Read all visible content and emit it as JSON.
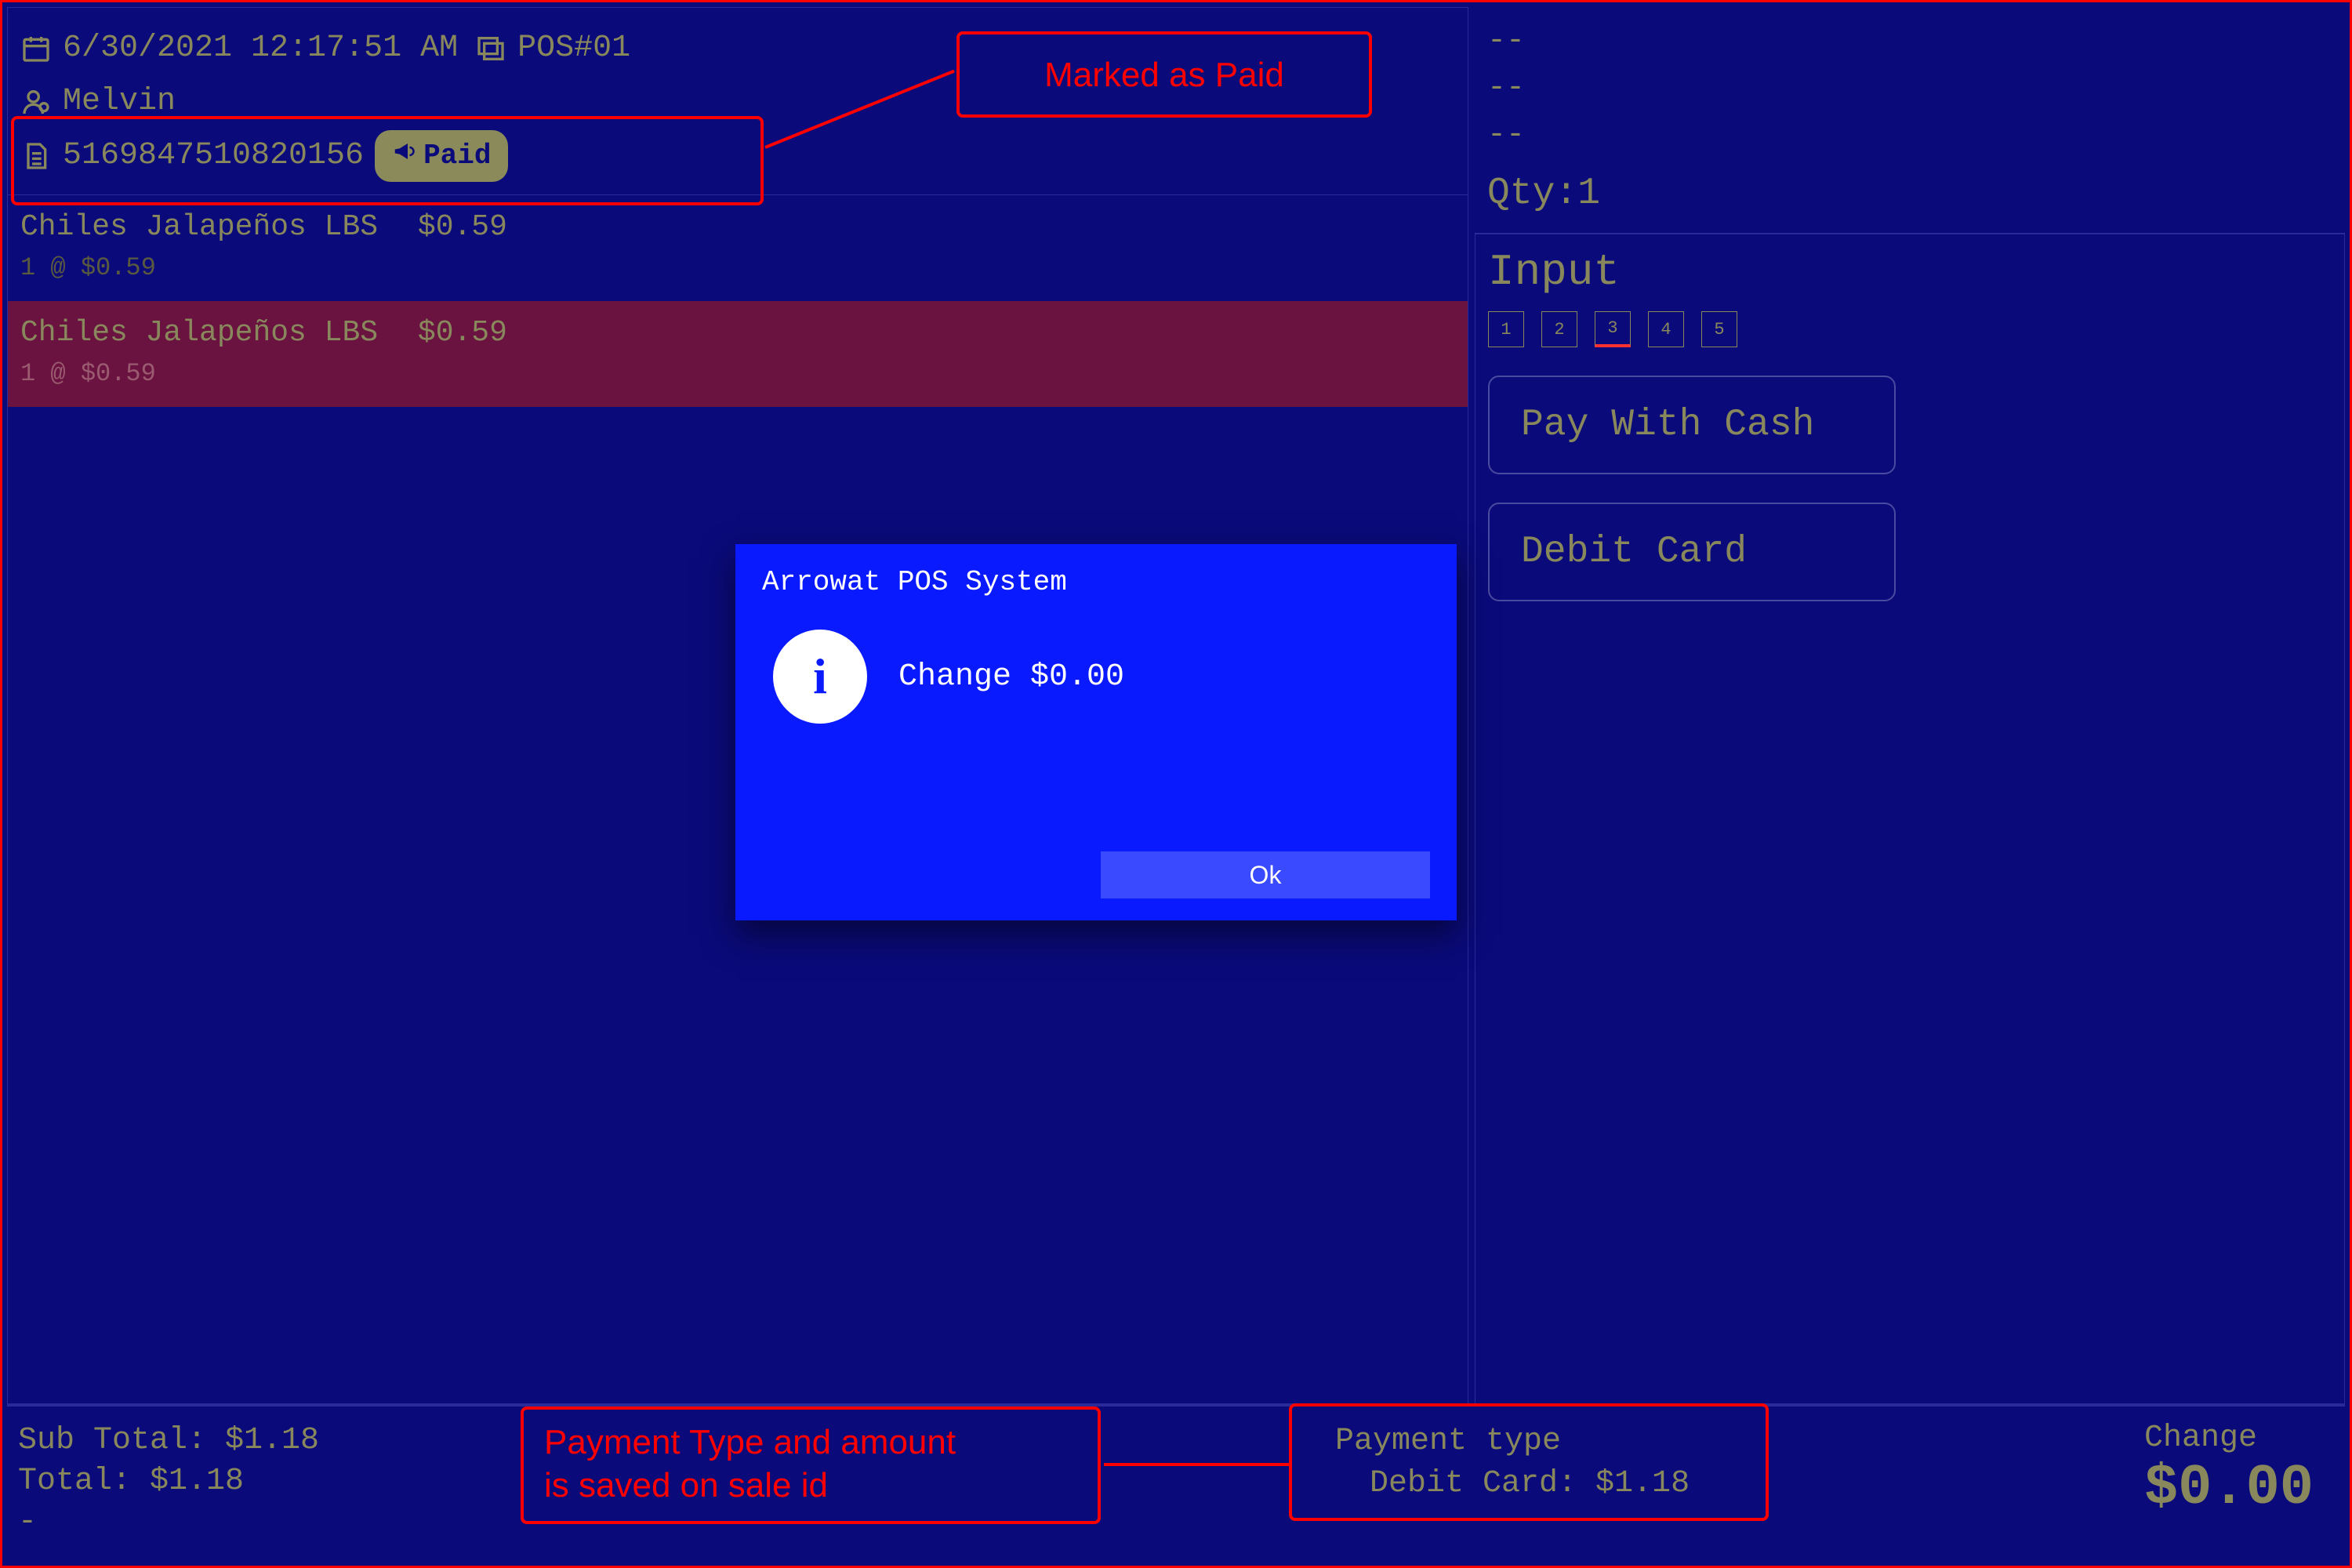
{
  "header": {
    "datetime": "6/30/2021 12:17:51 AM",
    "terminal": "POS#01",
    "cashier": "Melvin",
    "sale_id": "5169847510820156",
    "paid_label": "Paid"
  },
  "items": [
    {
      "name": "Chiles Jalapeños LBS",
      "price": "$0.59",
      "qtyline": "1 @ $0.59"
    },
    {
      "name": "Chiles Jalapeños LBS",
      "price": "$0.59",
      "qtyline": "1 @ $0.59"
    }
  ],
  "side": {
    "dash1": "--",
    "dash2": "--",
    "dash3": "--",
    "qty_label": "Qty:1",
    "input_title": "Input",
    "nums": [
      "1",
      "2",
      "3",
      "4",
      "5"
    ],
    "pay_cash": "Pay With Cash",
    "debit": "Debit Card"
  },
  "totals": {
    "sub": "Sub Total: $1.18",
    "tot": "Total: $1.18",
    "extra": "-",
    "payment_hdr": "Payment type",
    "payment_line": "Debit Card: $1.18",
    "change_label": "Change",
    "change_amt": "$0.00"
  },
  "modal": {
    "title": "Arrowat POS System",
    "message": "Change $0.00",
    "ok": "Ok"
  },
  "annotations": {
    "paid": "Marked as Paid",
    "ptype": "Payment Type and amount\nis saved on sale id"
  }
}
